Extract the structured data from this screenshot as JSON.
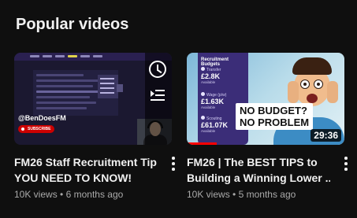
{
  "section": {
    "title": "Popular videos"
  },
  "videos": [
    {
      "title_line1": "FM26 Staff Recruitment Tip",
      "title_line2": "YOU NEED TO KNOW!",
      "views": "10K views",
      "age": "6 months ago",
      "thumbnail": {
        "handle": "@BenDoesFM",
        "subscribe": "SUBSCRIBE"
      },
      "overlay_icons": [
        "watch-later-icon",
        "add-to-queue-icon"
      ]
    },
    {
      "title_line1": "FM26 | The BEST TIPS to",
      "title_line2": "Building a Winning Lower ...",
      "views": "10K views",
      "age": "5 months ago",
      "duration": "29:36",
      "watched_fraction": 0.19,
      "thumbnail": {
        "panel_title": "Recruitment Budgets",
        "items": [
          {
            "label": "Transfer",
            "value": "£2.8K",
            "sub": "Available"
          },
          {
            "label": "Wage (p/w)",
            "value": "£1.63K",
            "sub": "Available"
          },
          {
            "label": "Scouting",
            "value": "£61.07K",
            "sub": "Available"
          }
        ],
        "caption_line1": "NO BUDGET?",
        "caption_line2": "NO PROBLEM"
      }
    }
  ],
  "colors": {
    "background": "#0f0f0f",
    "text": "#f1f1f1",
    "muted": "#aaaaaa",
    "progress": "#ff0000"
  }
}
